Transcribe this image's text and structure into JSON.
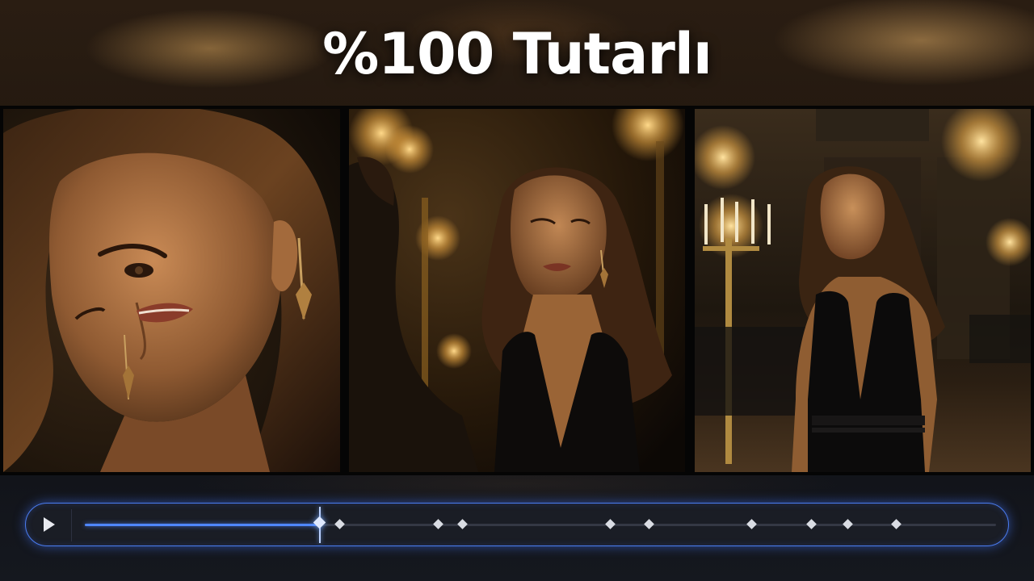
{
  "headline": "%100 Tutarlı",
  "frames": [
    {
      "name": "closeup-shot"
    },
    {
      "name": "medium-shot"
    },
    {
      "name": "wide-shot"
    }
  ],
  "timeline": {
    "accent_color": "#4f86ff",
    "play_icon": "play-icon",
    "progress": 0.258,
    "keyframes": [
      0.28,
      0.388,
      0.415,
      0.577,
      0.62,
      0.732,
      0.798,
      0.838,
      0.891
    ]
  }
}
